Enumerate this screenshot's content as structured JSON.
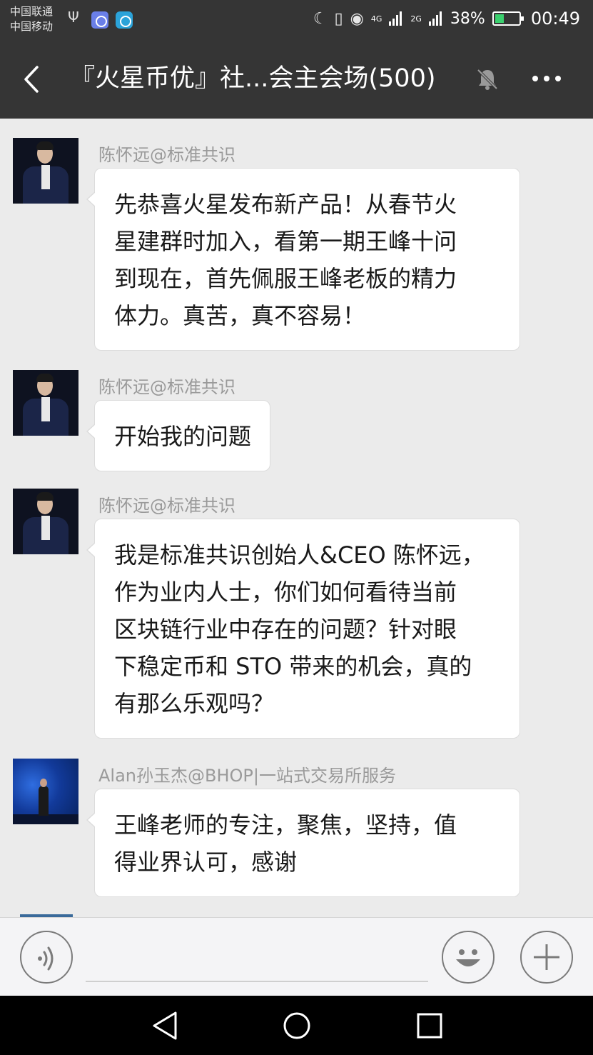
{
  "status_bar": {
    "carrier_1": "中国联通",
    "carrier_2": "中国移动",
    "network_1": "4G",
    "network_2": "2G",
    "battery": "38%",
    "time": "00:49"
  },
  "header": {
    "title": "『火星币优』社...会主会场(500)",
    "icons": [
      "back-icon",
      "mute-icon",
      "more-icon"
    ]
  },
  "messages": [
    {
      "sender": "陈怀远@标准共识",
      "lines": [
        "先恭喜火星发布新产品！从春节火",
        "星建群时加入，看第一期王峰十问",
        "到现在，首先佩服王峰老板的精力",
        "体力。真苦，真不容易！"
      ]
    },
    {
      "sender": "陈怀远@标准共识",
      "lines": [
        "开始我的问题"
      ]
    },
    {
      "sender": "陈怀远@标准共识",
      "lines": [
        "我是标准共识创始人&CEO 陈怀远，",
        "作为业内人士，你们如何看待当前",
        "区块链行业中存在的问题？针对眼",
        "下稳定币和 STO 带来的机会，真的",
        "有那么乐观吗？"
      ]
    },
    {
      "sender": "Alan孙玉杰@BHOP|一站式交易所服务",
      "lines": [
        "王峰老师的专注，聚焦，坚持，值",
        "得业界认可，感谢"
      ]
    }
  ],
  "input_bar": {
    "icons": [
      "voice-icon",
      "emoji-icon",
      "plus-icon"
    ]
  },
  "nav_bar": {
    "icons": [
      "nav-back-icon",
      "nav-home-icon",
      "nav-recent-icon"
    ]
  },
  "colors": {
    "bar_dark": "#353535",
    "chat_bg": "#ebebeb",
    "bubble_bg": "#ffffff",
    "sender_gray": "#9a9a9a",
    "battery_green": "#3bd16f"
  }
}
